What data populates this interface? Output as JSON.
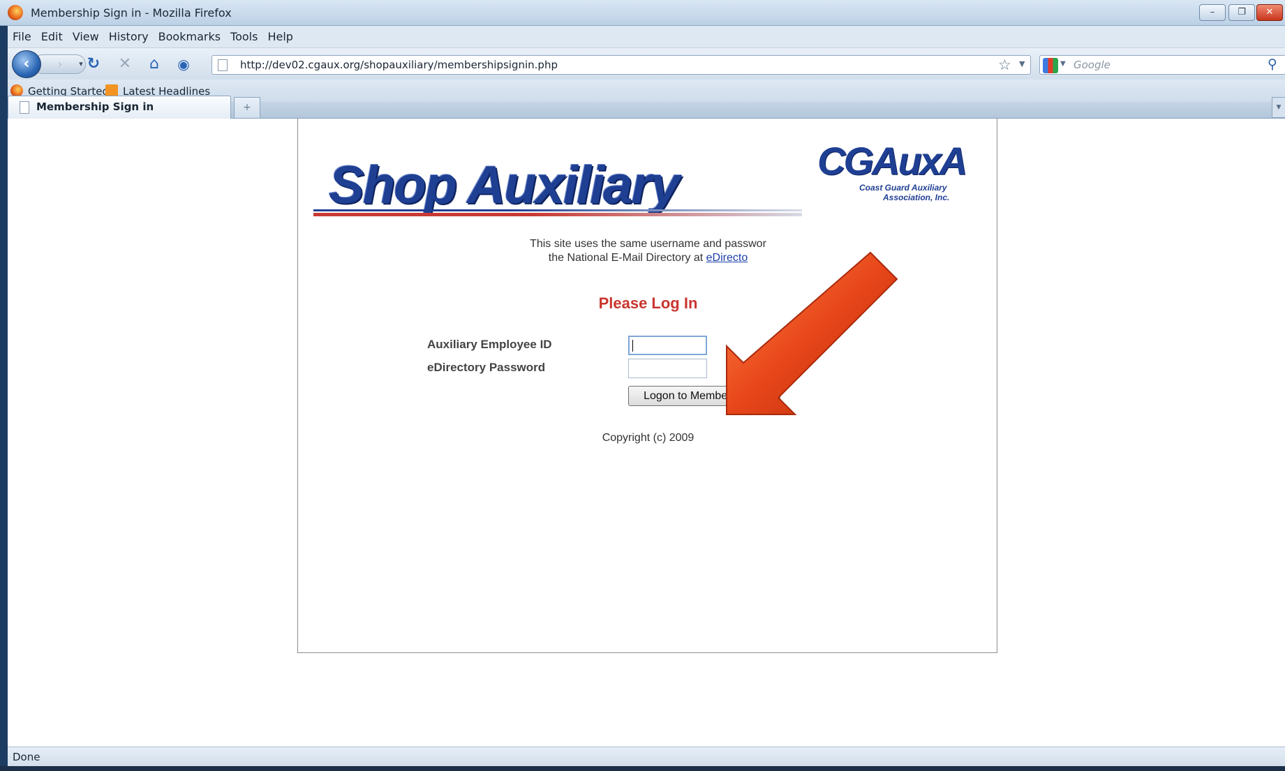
{
  "window": {
    "title": "Membership Sign in - Mozilla Firefox",
    "controls": {
      "minimize": "–",
      "maximize": "❐",
      "close": "✕"
    }
  },
  "menu": [
    "File",
    "Edit",
    "View",
    "History",
    "Bookmarks",
    "Tools",
    "Help"
  ],
  "navigation": {
    "url": "http://dev02.cgaux.org/shopauxiliary/membershipsignin.php",
    "search_placeholder": "Google"
  },
  "bookmarks": [
    "Getting Started",
    "Latest Headlines"
  ],
  "tabs": [
    {
      "label": "Membership Sign in",
      "active": true
    }
  ],
  "page": {
    "logo_text": "Shop Auxiliary",
    "org_logo": {
      "mark": "CGAuxA",
      "line1": "Coast Guard Auxiliary",
      "line2": "Association, Inc."
    },
    "notice_line1": "This site uses the same username and passwor",
    "notice_line2_prefix": "the National E-Mail Directory at ",
    "notice_link": "eDirecto",
    "heading": "Please Log In",
    "fields": {
      "employee_id_label": "Auxiliary Employee ID",
      "employee_id_value": "",
      "password_label": "eDirectory Password",
      "password_value": ""
    },
    "submit_label": "Logon to Member's Only",
    "copyright": "Copyright (c) 2009"
  },
  "status": "Done",
  "colors": {
    "heading_red": "#c9362f",
    "logo_blue": "#1f3f93",
    "arrow_orange": "#e8461a",
    "link_blue": "#1a3da8"
  },
  "icons": [
    "firefox-icon",
    "back-arrow-icon",
    "forward-arrow-icon",
    "reload-icon",
    "stop-icon",
    "home-icon",
    "web-of-trust-icon",
    "page-icon",
    "bookmark-star-icon",
    "google-icon",
    "search-icon",
    "rss-feed-icon",
    "new-tab-icon",
    "annotation-arrow"
  ]
}
